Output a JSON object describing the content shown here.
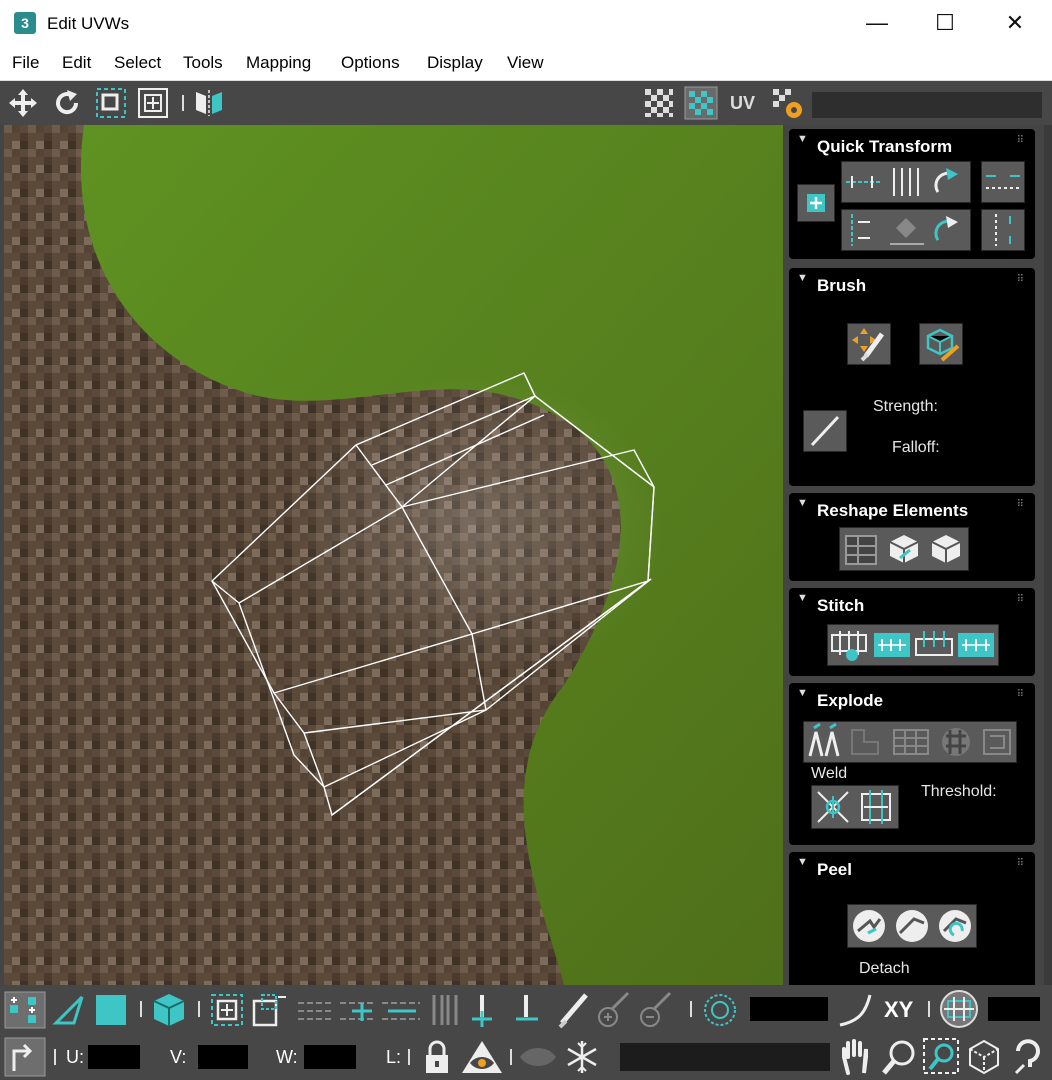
{
  "window": {
    "title": "Edit UVWs",
    "app_icon": "3",
    "minimize": "—",
    "maximize": "☐",
    "close": "✕"
  },
  "menu": [
    "File",
    "Edit",
    "Select",
    "Tools",
    "Mapping",
    "Options",
    "Display",
    "View"
  ],
  "toolbar": {
    "uv_label": "UV"
  },
  "panels": {
    "quick_transform": {
      "title": "Quick Transform"
    },
    "brush": {
      "title": "Brush",
      "strength_label": "Strength:",
      "falloff_label": "Falloff:"
    },
    "reshape": {
      "title": "Reshape Elements"
    },
    "stitch": {
      "title": "Stitch"
    },
    "explode": {
      "title": "Explode",
      "weld_label": "Weld",
      "threshold_label": "Threshold:"
    },
    "peel": {
      "title": "Peel",
      "detach_label": "Detach"
    }
  },
  "status": {
    "xy_label": "XY",
    "u_label": "U:",
    "v_label": "V:",
    "w_label": "W:",
    "l_label": "L:"
  },
  "colors": {
    "accent": "#3ec5c5",
    "panel_bg": "#000000",
    "toolbar_bg": "#474747",
    "wire": "#ffffff"
  }
}
